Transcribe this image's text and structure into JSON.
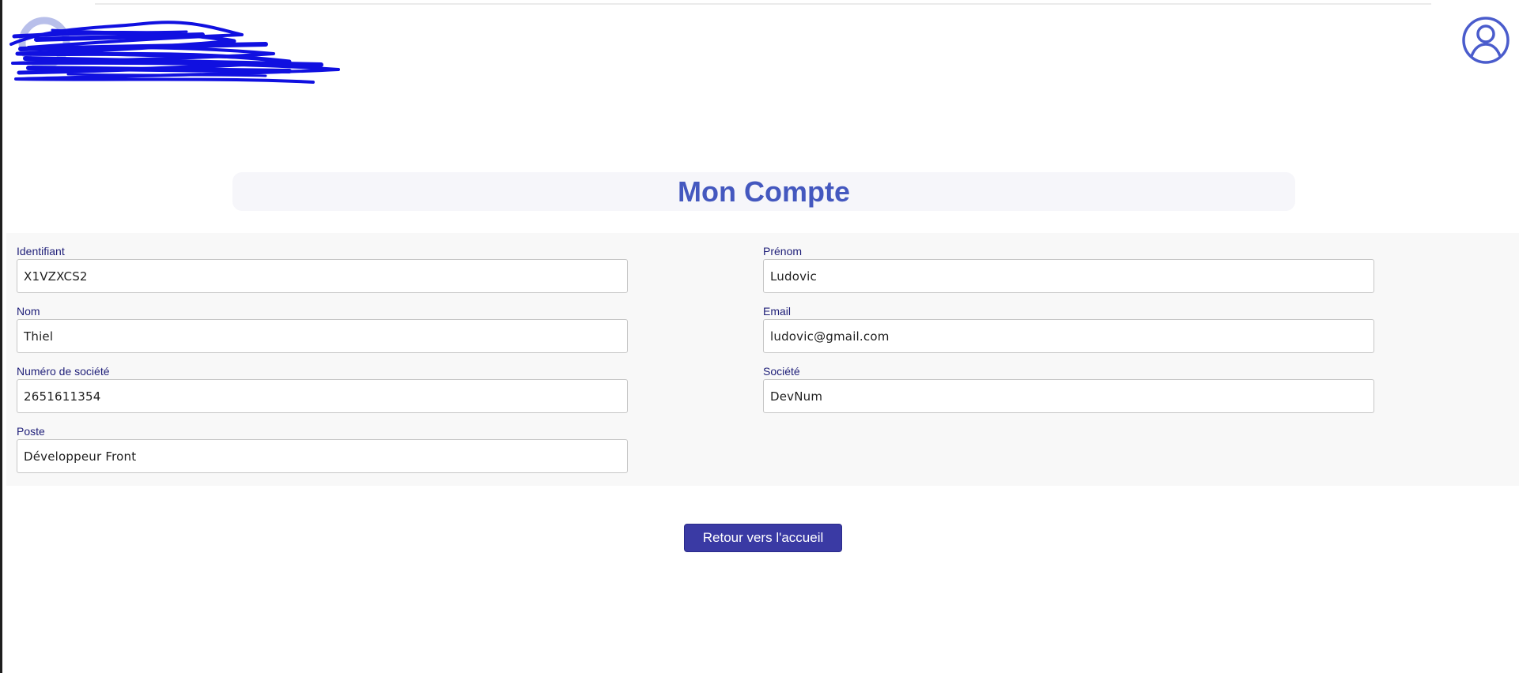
{
  "header": {
    "logo_icon": "company-logo",
    "avatar_icon": "user-circle-icon"
  },
  "page": {
    "title": "Mon Compte"
  },
  "form": {
    "identifiant": {
      "label": "Identifiant",
      "value": "X1VZXCS2"
    },
    "prenom": {
      "label": "Prénom",
      "value": "Ludovic"
    },
    "nom": {
      "label": "Nom",
      "value": "Thiel"
    },
    "email": {
      "label": "Email",
      "value": "ludovic@gmail.com"
    },
    "numero_societe": {
      "label": "Numéro de société",
      "value": "2651611354"
    },
    "societe": {
      "label": "Société",
      "value": "DevNum"
    },
    "poste": {
      "label": "Poste",
      "value": "Développeur Front"
    }
  },
  "actions": {
    "back_label": "Retour vers l'accueil"
  },
  "colors": {
    "title": "#4458bf",
    "button": "#3a3aa4",
    "label": "#1e1e78",
    "avatar": "#4a5ccc",
    "scribble": "#1010e0"
  }
}
